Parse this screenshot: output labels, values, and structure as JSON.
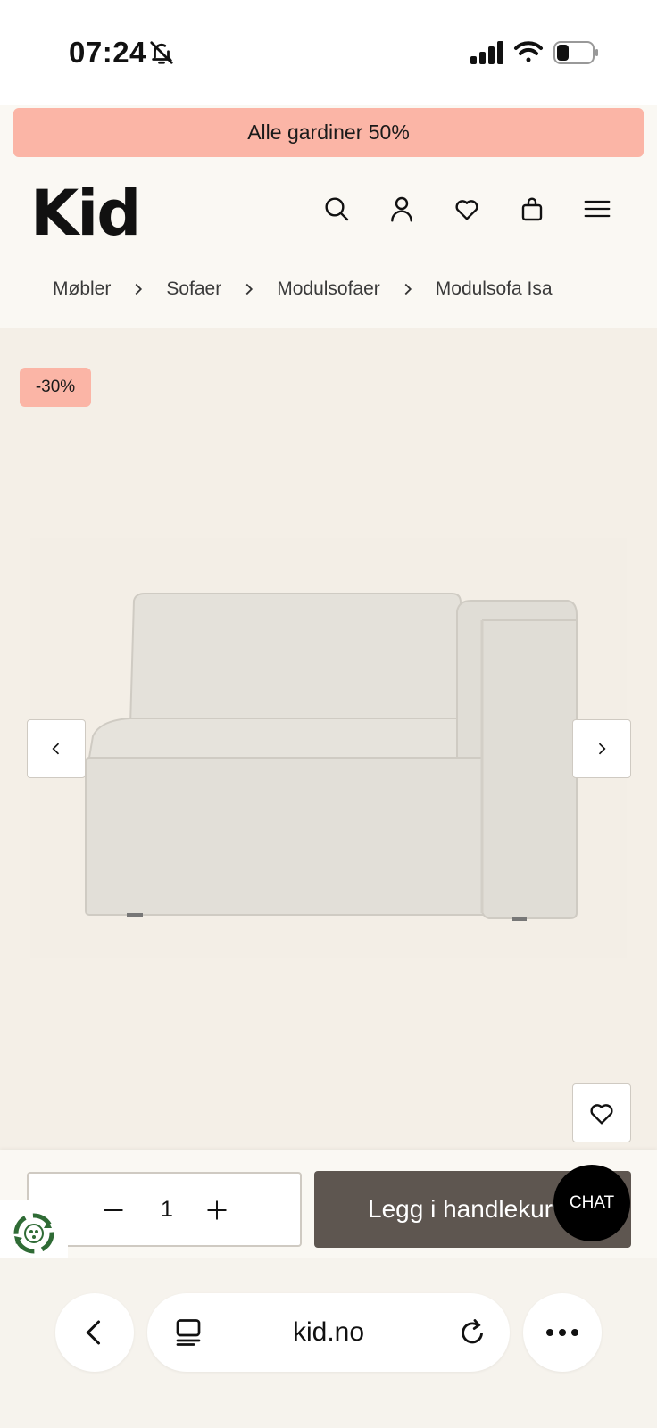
{
  "status_bar": {
    "time": "07:24",
    "icons": [
      "bell-off-icon",
      "signal-icon",
      "wifi-icon",
      "battery-icon"
    ]
  },
  "promo": {
    "text": "Alle gardiner 50%"
  },
  "header": {
    "logo": "Kid",
    "icons": [
      "search-icon",
      "user-icon",
      "heart-icon",
      "bag-icon",
      "menu-icon"
    ]
  },
  "breadcrumb": [
    "Møbler",
    "Sofaer",
    "Modulsofaer",
    "Modulsofa Isa"
  ],
  "product": {
    "discount_badge": "-30%",
    "image": "sofa-module-image"
  },
  "purchase": {
    "quantity": "1",
    "add_to_cart_label": "Legg i handlekurv"
  },
  "chat": {
    "label": "CHAT"
  },
  "browser": {
    "url": "kid.no"
  },
  "colors": {
    "accent_pink": "#fbb5a6",
    "cart_button": "#5e5650",
    "gallery_bg": "#f4efe7"
  }
}
